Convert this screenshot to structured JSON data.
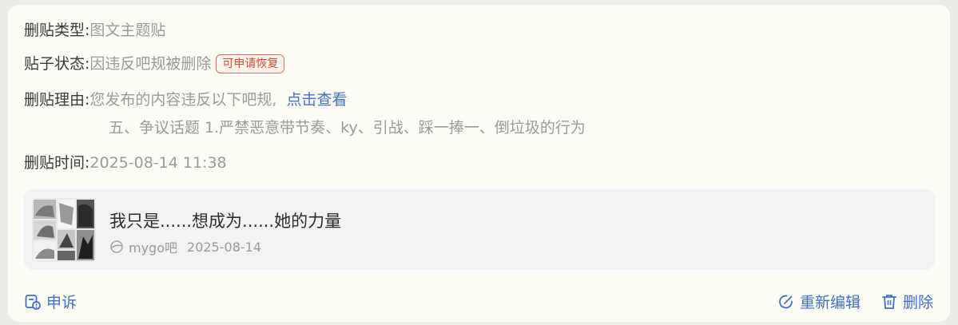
{
  "info": {
    "type_label": "删贴类型:",
    "type_value": "图文主题贴",
    "status_label": "贴子状态:",
    "status_value": "因违反吧规被删除",
    "status_badge": "可申请恢复",
    "reason_label": "删贴理由:",
    "reason_value": "您发布的内容违反以下吧规,",
    "reason_link": "点击查看",
    "reason_detail": "五、争议话题 1.严禁恶意带节奏、ky、引战、踩一捧一、倒垃圾的行为",
    "time_label": "删贴时间:",
    "time_value": "2025-08-14 11:38"
  },
  "post": {
    "title": "我只是......想成为......她的力量",
    "forum": "mygo吧",
    "date": "2025-08-14"
  },
  "actions": {
    "appeal": "申诉",
    "reedit": "重新编辑",
    "delete": "删除"
  },
  "colors": {
    "accent_blue": "#3e70c6",
    "badge_red": "#d34a33",
    "card_bg": "#fdfcf4"
  }
}
